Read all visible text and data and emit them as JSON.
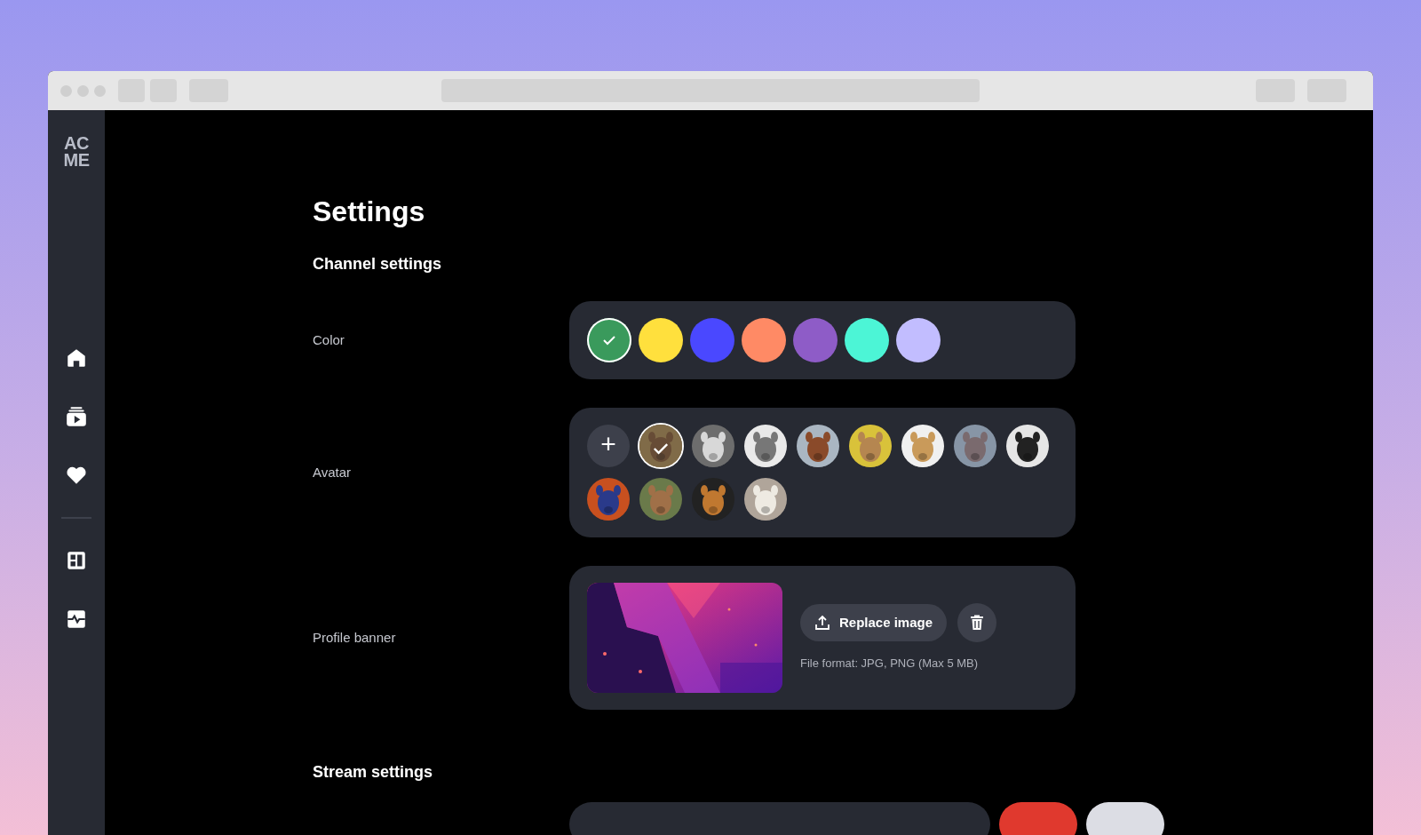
{
  "sidebar": {
    "logo": [
      "AC",
      "ME"
    ],
    "items": [
      {
        "kind": "home"
      },
      {
        "kind": "video"
      },
      {
        "kind": "heart"
      },
      {
        "kind": "divider"
      },
      {
        "kind": "dashboard"
      },
      {
        "kind": "pulse"
      }
    ]
  },
  "page": {
    "title": "Settings",
    "channel_settings": {
      "heading": "Channel settings",
      "color": {
        "label": "Color",
        "swatches": [
          {
            "color": "#3a9a5c",
            "selected": true
          },
          {
            "color": "#ffe03d",
            "selected": false
          },
          {
            "color": "#4a48ff",
            "selected": false
          },
          {
            "color": "#ff8a65",
            "selected": false
          },
          {
            "color": "#8e5cc7",
            "selected": false
          },
          {
            "color": "#4cf5d6",
            "selected": false
          },
          {
            "color": "#c2bdff",
            "selected": false
          }
        ]
      },
      "avatar": {
        "label": "Avatar",
        "add_symbol": "+",
        "avatars": [
          {
            "kind": "picture",
            "selected": true
          },
          {
            "kind": "picture",
            "selected": false
          },
          {
            "kind": "picture",
            "selected": false
          },
          {
            "kind": "picture",
            "selected": false
          },
          {
            "kind": "picture",
            "selected": false
          },
          {
            "kind": "picture",
            "selected": false
          },
          {
            "kind": "picture",
            "selected": false
          },
          {
            "kind": "picture",
            "selected": false
          },
          {
            "kind": "picture",
            "selected": false
          },
          {
            "kind": "picture",
            "selected": false
          },
          {
            "kind": "picture",
            "selected": false
          },
          {
            "kind": "picture",
            "selected": false
          }
        ]
      },
      "banner": {
        "label": "Profile banner",
        "replace_button": "Replace image",
        "hint": "File format: JPG, PNG (Max 5 MB)"
      }
    },
    "stream_settings": {
      "heading": "Stream settings",
      "actions": [
        {
          "kind": "danger"
        },
        {
          "kind": "secondary"
        }
      ]
    }
  }
}
